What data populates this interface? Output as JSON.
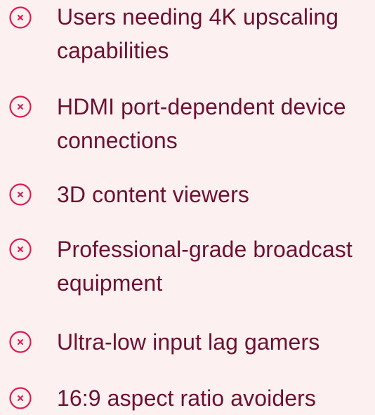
{
  "accent_color": "#e01a4f",
  "text_color": "#6e1030",
  "background_color": "#fdf0f1",
  "items": [
    {
      "icon": "x-circle-icon",
      "label": "Users needing 4K upscaling capabilities"
    },
    {
      "icon": "x-circle-icon",
      "label": "HDMI port-dependent device connections"
    },
    {
      "icon": "x-circle-icon",
      "label": "3D content viewers"
    },
    {
      "icon": "x-circle-icon",
      "label": "Professional-grade broadcast equipment"
    },
    {
      "icon": "x-circle-icon",
      "label": "Ultra-low input lag gamers"
    },
    {
      "icon": "x-circle-icon",
      "label": "16:9 aspect ratio avoiders"
    }
  ]
}
